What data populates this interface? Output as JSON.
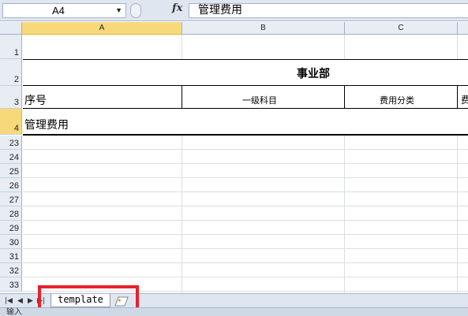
{
  "formula_bar": {
    "name_box": "A4",
    "fx": "fx",
    "content": "管理费用"
  },
  "columns": [
    "A",
    "B",
    "C"
  ],
  "rows": {
    "r1": "1",
    "r2": "2",
    "r3": "3",
    "r4": "4",
    "visible": [
      "23",
      "24",
      "25",
      "26",
      "27",
      "28",
      "29",
      "30",
      "31",
      "32",
      "33"
    ]
  },
  "cells": {
    "title": "事业部",
    "seq": "序号",
    "level1": "一级科目",
    "category": "费用分类",
    "partial": "费",
    "a4": "管理费用"
  },
  "sheet_tabs": {
    "active": "template"
  },
  "status": {
    "mode": "输入"
  }
}
